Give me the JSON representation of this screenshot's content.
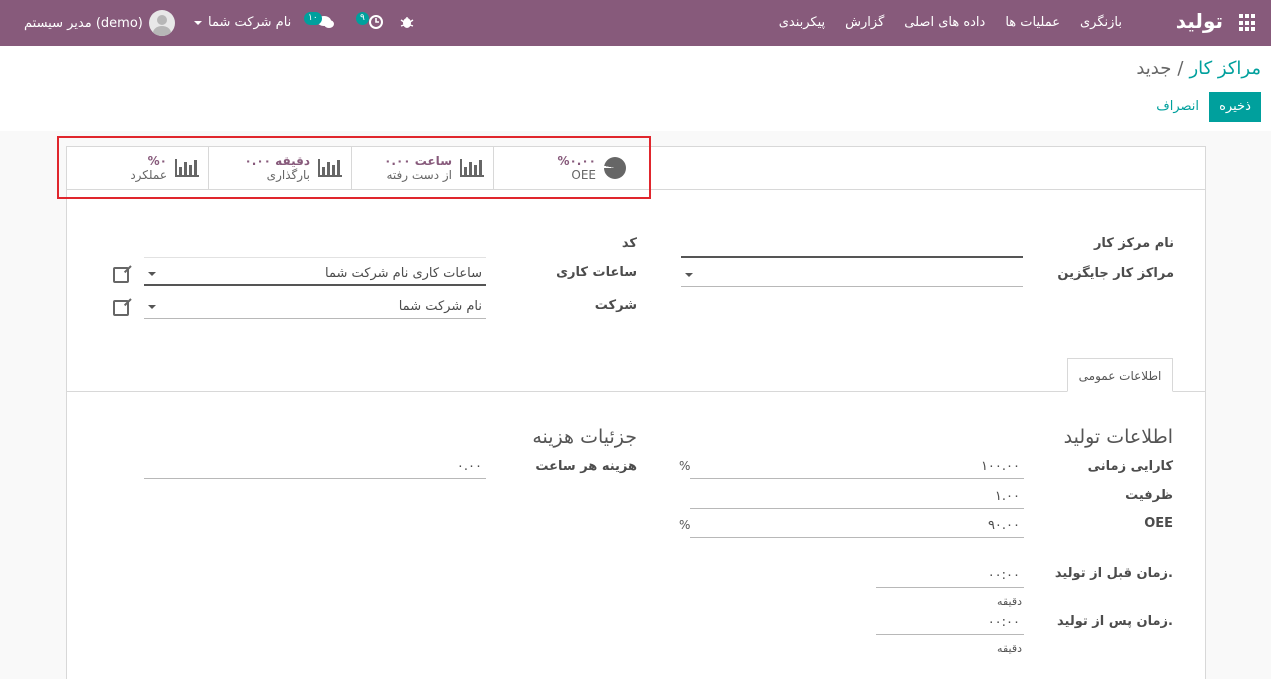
{
  "navbar": {
    "brand": "تولید",
    "menu": [
      "بازنگری",
      "عملیات ها",
      "داده های اصلی",
      "گزارش",
      "پیکربندی"
    ],
    "user": "مدیر سیستم (demo)",
    "company": "نام شرکت شما",
    "chat_count": "۱۰",
    "activity_count": "۹"
  },
  "breadcrumb": {
    "parent": "مراکز کار",
    "separator": "/",
    "current": "جدید"
  },
  "actions": {
    "save": "ذخیره",
    "discard": "انصراف"
  },
  "stat_buttons": [
    {
      "value": "%۰.۰۰",
      "label": "OEE",
      "icon": "pie-chart-icon"
    },
    {
      "value": "۰.۰۰ ساعت",
      "label": "از دست رفته",
      "icon": "bar-chart-icon"
    },
    {
      "value": "۰.۰۰ دقیقه",
      "label": "بارگذاری",
      "icon": "bar-chart-icon"
    },
    {
      "value": "%۰",
      "label": "عملکرد",
      "icon": "bar-chart-icon"
    }
  ],
  "form": {
    "name_label": "نام مرکز کار",
    "alt_label": "مراکز کار جایگزین",
    "code_label": "کد",
    "hours_label": "ساعات کاری",
    "hours_value": "ساعات کاری نام شرکت شما",
    "company_label": "شرکت",
    "company_value": "نام شرکت شما"
  },
  "tab": {
    "general": "اطلاعات عمومی"
  },
  "production": {
    "title": "اطلاعات تولید",
    "time_eff_label": "کارایی زمانی",
    "time_eff_value": "۱۰۰.۰۰",
    "capacity_label": "ظرفیت",
    "capacity_value": "۱.۰۰",
    "oee_label": "OEE",
    "oee_value": "۹۰.۰۰",
    "pct": "%",
    "setup_label": "زمان قبل از تولید.",
    "setup_value": "۰۰:۰۰",
    "cleanup_label": "زمان پس از تولید.",
    "cleanup_value": "۰۰:۰۰",
    "minutes": "دقیقه"
  },
  "cost": {
    "title": "جزئیات هزینه",
    "hour_label": "هزینه هر ساعت",
    "hour_value": "۰.۰۰"
  }
}
